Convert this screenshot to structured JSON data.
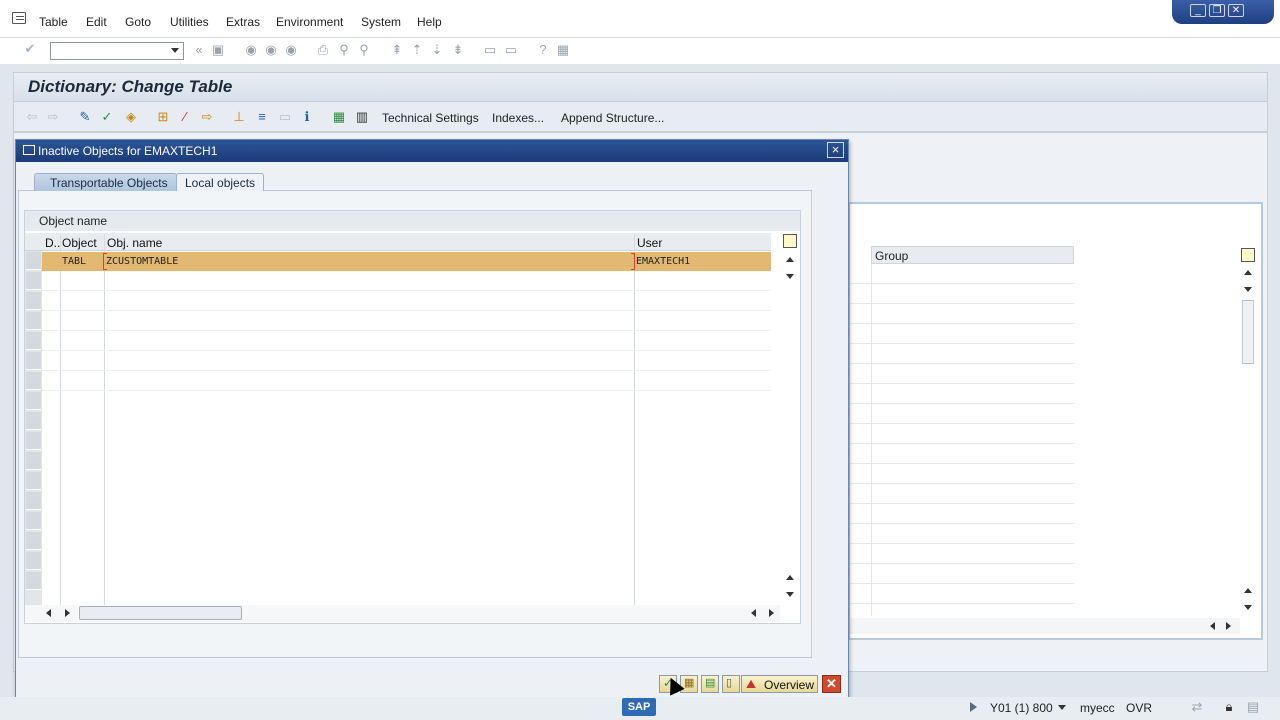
{
  "menubar": {
    "items": [
      "Table",
      "Edit",
      "Goto",
      "Utilities",
      "Extras",
      "Environment",
      "System",
      "Help"
    ]
  },
  "page": {
    "title": "Dictionary: Change Table"
  },
  "app_toolbar": {
    "technical_settings": "Technical Settings",
    "indexes": "Indexes...",
    "append_structure": "Append Structure..."
  },
  "background_table": {
    "group_header": "Group"
  },
  "dialog": {
    "title": "Inactive Objects for EMAXTECH1",
    "tabs": [
      {
        "label": "Transportable Objects",
        "active": true
      },
      {
        "label": "Local objects",
        "active": false
      }
    ],
    "grid": {
      "caption": "Object name",
      "columns": [
        "D..",
        "Object",
        "Obj. name",
        "User"
      ],
      "rows": [
        {
          "d": "",
          "object": "TABL",
          "obj_name": "ZCUSTOMTABLE",
          "user": "EMAXTECH1"
        }
      ]
    },
    "footer": {
      "overview_label": "Overview"
    }
  },
  "statusbar": {
    "system": "Y01 (1) 800",
    "server": "myecc",
    "mode": "OVR"
  },
  "colors": {
    "selected_row": "#e2b872",
    "dialog_titlebar": "#1f4585",
    "cancel_button": "#d24a2c"
  }
}
